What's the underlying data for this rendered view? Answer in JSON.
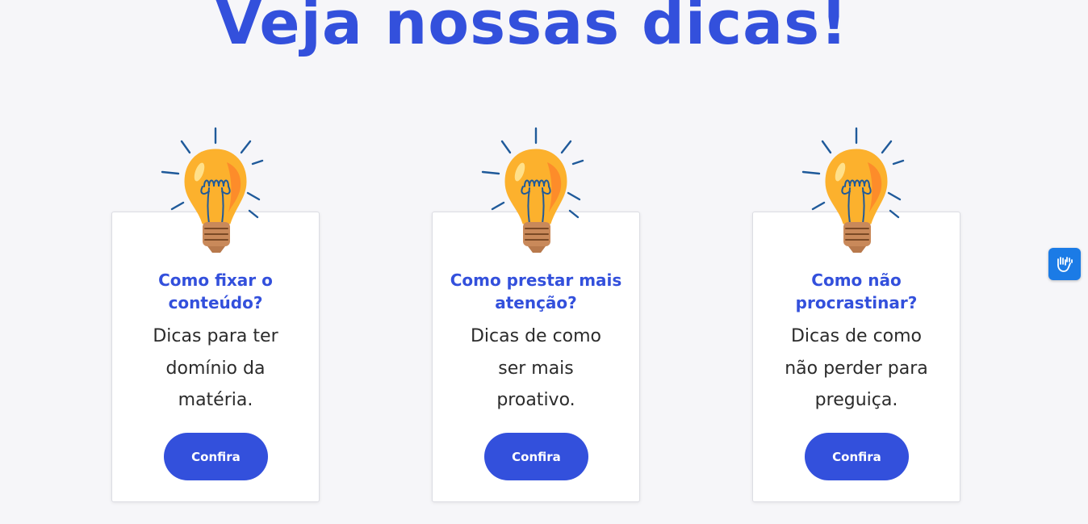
{
  "heading": {
    "title": "Veja nossas dicas!"
  },
  "cards": [
    {
      "title": "Como fixar o conteúdo?",
      "description": "Dicas para ter domínio da matéria.",
      "button_label": "Confira",
      "icon": "lightbulb-icon"
    },
    {
      "title": "Como prestar mais atenção?",
      "description": "Dicas de como ser mais proativo.",
      "button_label": "Confira",
      "icon": "lightbulb-icon"
    },
    {
      "title": "Como não procrastinar?",
      "description": "Dicas de como não perder para preguiça.",
      "button_label": "Confira",
      "icon": "lightbulb-icon"
    }
  ],
  "accessibility": {
    "icon": "sign-language-hands-icon"
  },
  "colors": {
    "primary": "#3350dc",
    "background": "#f6f6f9",
    "card": "#ffffff",
    "bulb_glass": "#fcb12d",
    "bulb_highlight": "#fd8c2a",
    "bulb_base": "#c9895a",
    "bulb_lines": "#1f5a9a",
    "accessibility": "#1b7be6"
  }
}
